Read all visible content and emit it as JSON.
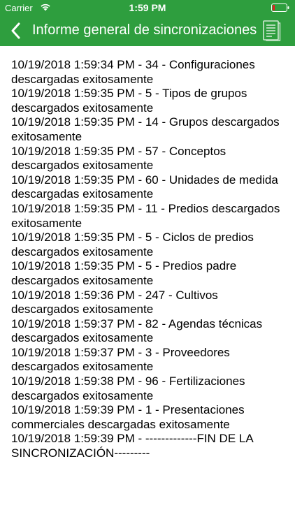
{
  "status_bar": {
    "carrier": "Carrier",
    "time": "1:59 PM",
    "wifi_icon": "wifi-icon",
    "battery_icon": "battery-icon"
  },
  "nav_bar": {
    "title": "Informe general de sincronizaciones",
    "back_icon": "chevron-left-icon",
    "action_icon": "report-document-icon",
    "color": "#2e9e3e"
  },
  "log": {
    "lines": [
      "10/19/2018 1:59:34 PM - 34 - Configuraciones descargadas exitosamente",
      "10/19/2018 1:59:35 PM - 5 - Tipos de grupos descargados exitosamente",
      "10/19/2018 1:59:35 PM - 14 - Grupos descargados exitosamente",
      "10/19/2018 1:59:35 PM - 57 - Conceptos descargados exitosamente",
      "10/19/2018 1:59:35 PM - 60 - Unidades de medida descargadas exitosamente",
      "10/19/2018 1:59:35 PM - 11 - Predios descargados exitosamente",
      "10/19/2018 1:59:35 PM - 5 - Ciclos de predios descargados exitosamente",
      "10/19/2018 1:59:35 PM - 5 - Predios padre descargados exitosamente",
      "10/19/2018 1:59:36 PM - 247 - Cultivos descargados exitosamente",
      "10/19/2018 1:59:37 PM - 82 - Agendas técnicas descargados exitosamente",
      "10/19/2018 1:59:37 PM - 3 - Proveedores descargados exitosamente",
      "10/19/2018 1:59:38 PM - 96 - Fertilizaciones descargados exitosamente",
      "10/19/2018 1:59:39 PM - 1 - Presentaciones commerciales descargadas exitosamente",
      "10/19/2018 1:59:39 PM - -------------FIN DE LA SINCRONIZACIÓN---------"
    ]
  }
}
